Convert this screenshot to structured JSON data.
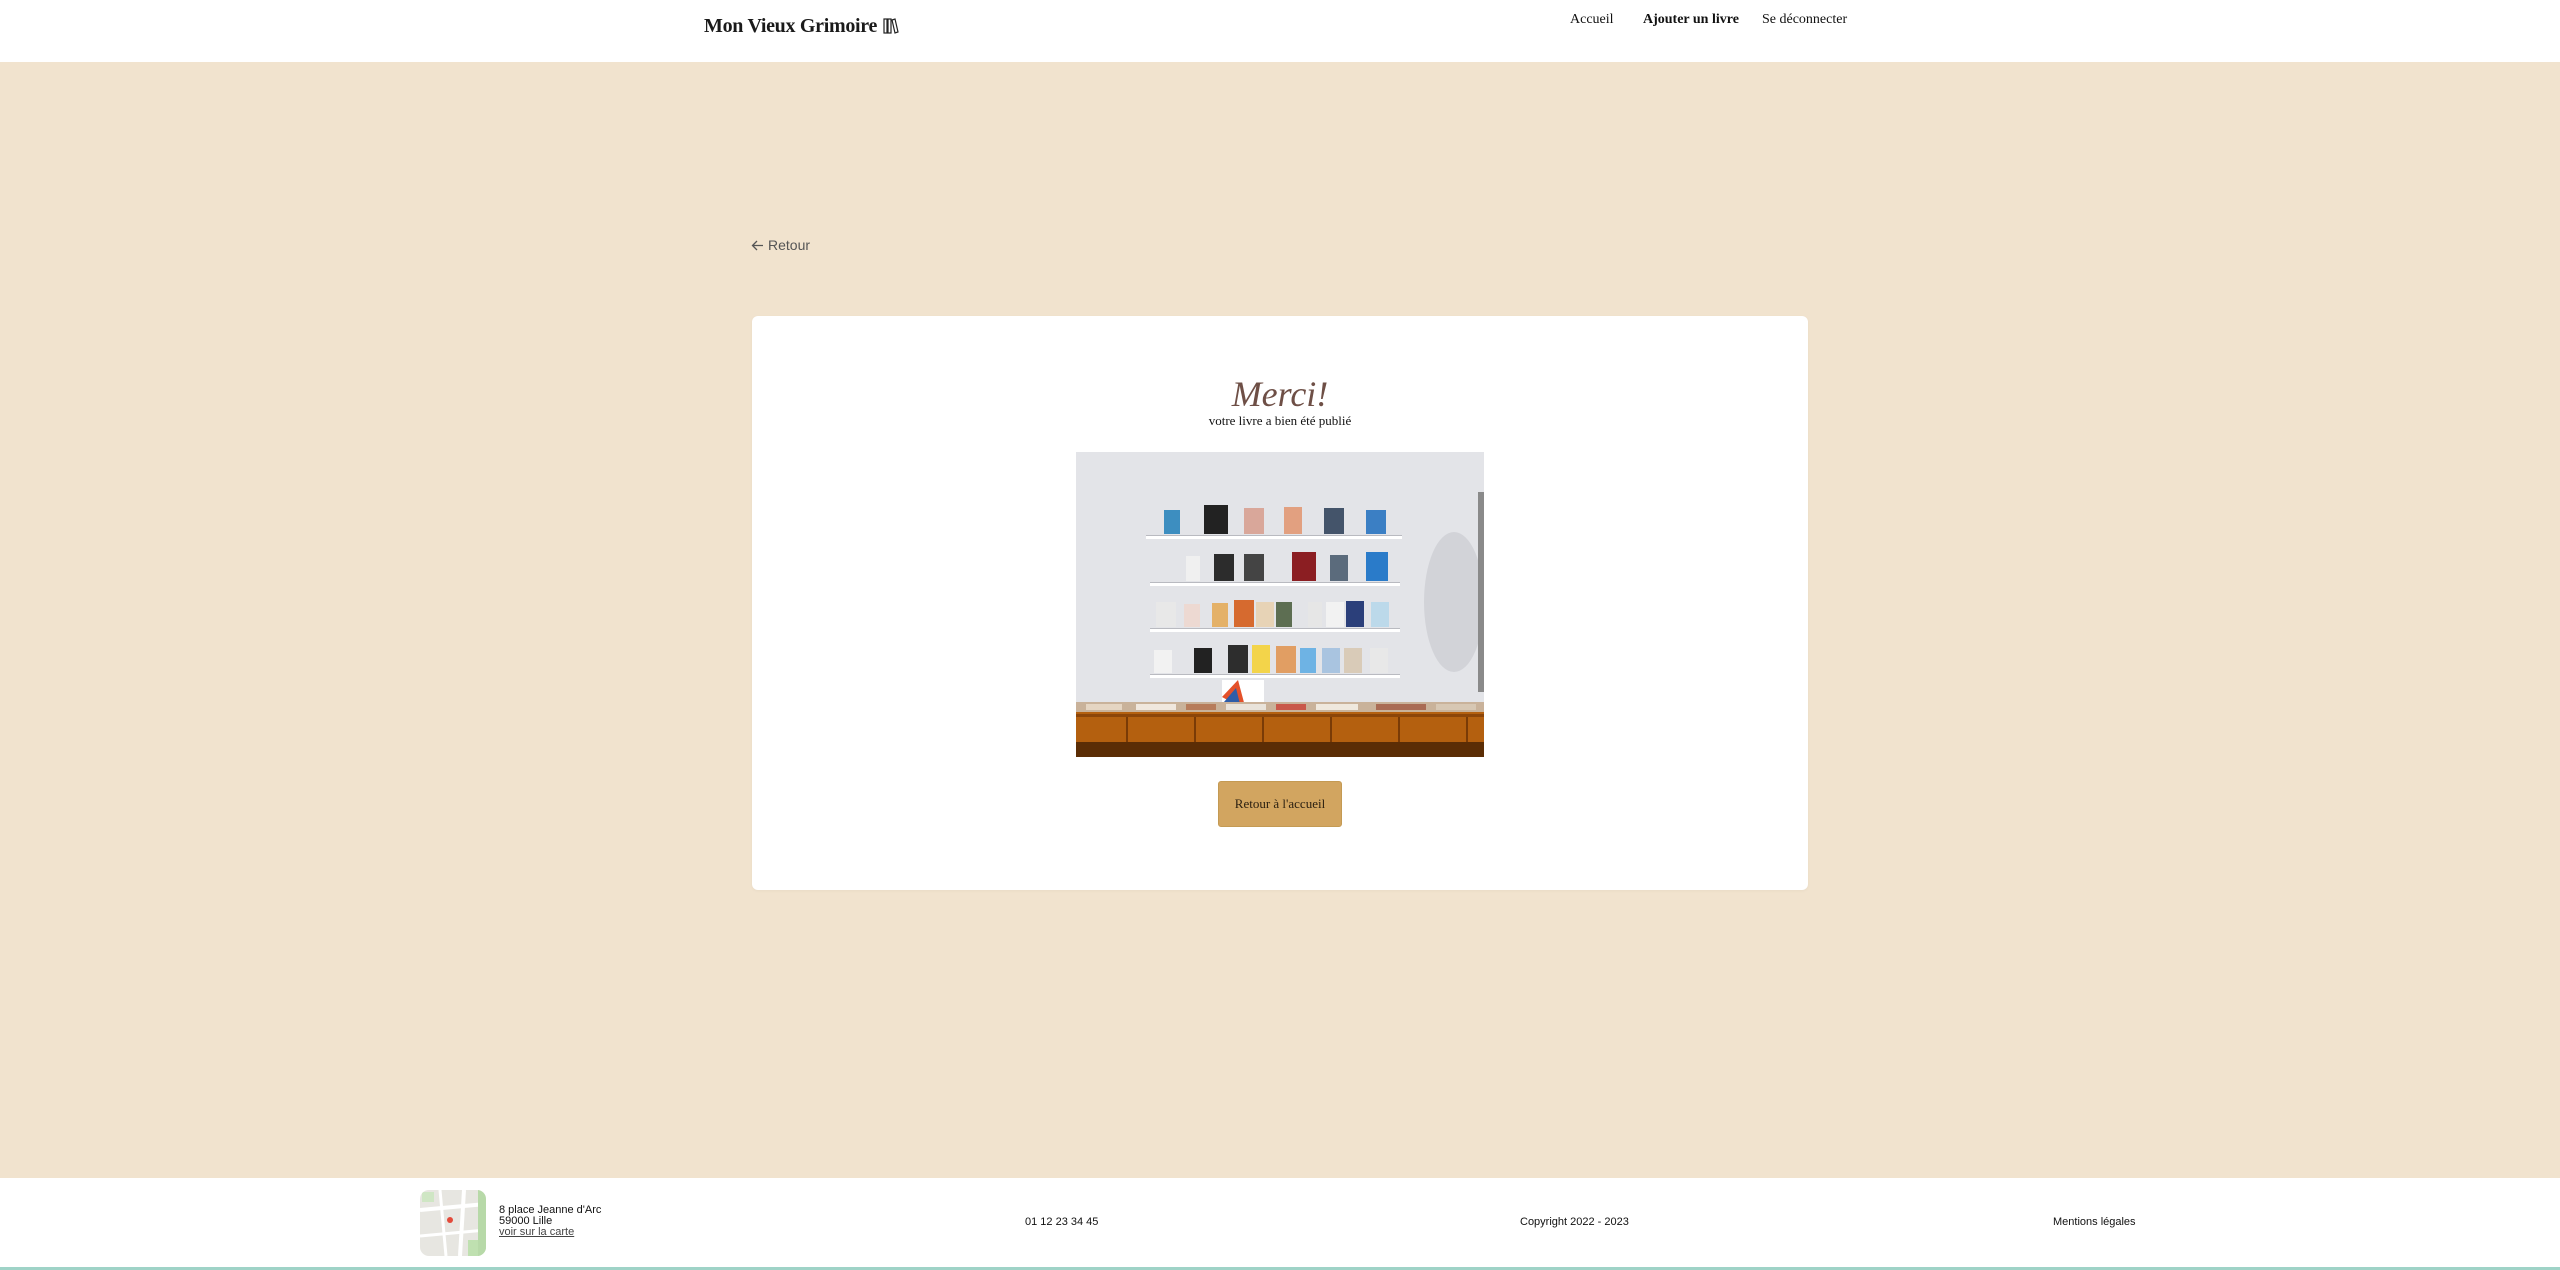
{
  "header": {
    "logo_text": "Mon Vieux Grimoire",
    "logo_icon": "book-icon",
    "nav": {
      "home": "Accueil",
      "add_book": "Ajouter un livre",
      "logout": "Se déconnecter"
    }
  },
  "back_link": {
    "label": "Retour",
    "icon": "arrow-left-icon"
  },
  "confirmation": {
    "title": "Merci!",
    "subtitle": "votre livre a bien été publié",
    "image_alt": "bookshelf-photo",
    "button_label": "Retour à l'accueil"
  },
  "footer": {
    "address_line1": "8 place Jeanne d'Arc",
    "address_line2": "59000 Lille",
    "map_link": "voir sur la carte",
    "phone": "01 12 23 34 45",
    "copyright": "Copyright 2022 - 2023",
    "legal": "Mentions légales"
  },
  "colors": {
    "background": "#F1E3CE",
    "card": "#FFFFFF",
    "title": "#6E4F46",
    "button": "#D2A560",
    "footer_accent": "#9FD3C7"
  }
}
